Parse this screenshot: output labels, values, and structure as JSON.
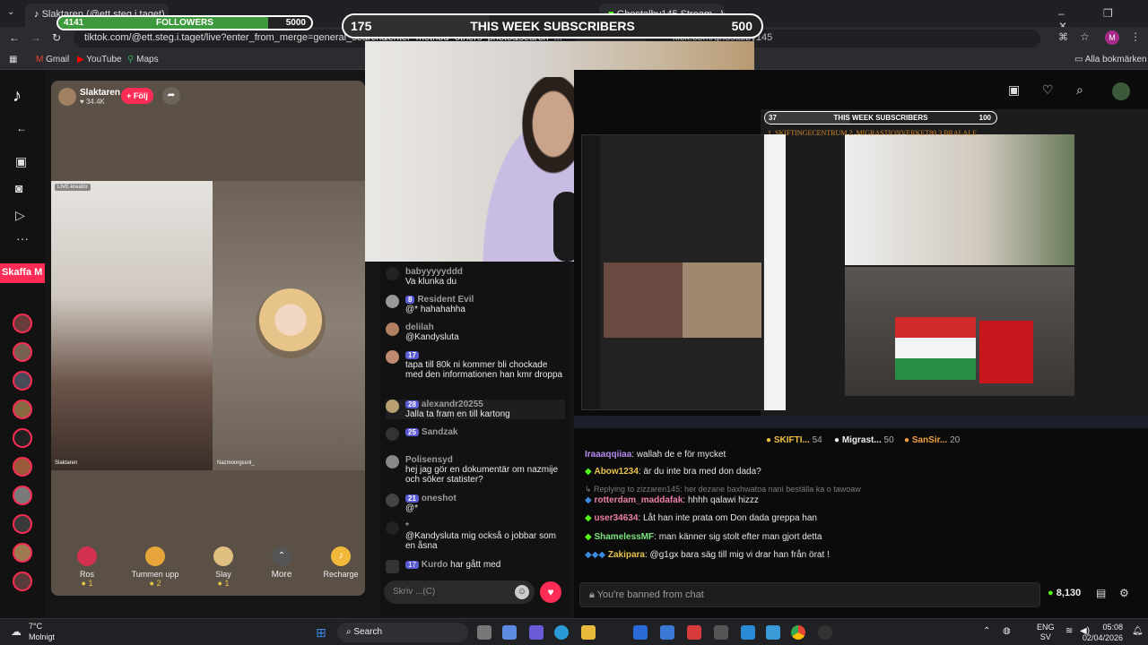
{
  "browser_left": {
    "tab_title": "Slaktaren (@ett.steg.i.taget)",
    "url": "tiktok.com/@ett.steg.i.taget/live?enter_from_merge=general_search&enter_method=others_photo&search_..."
  },
  "browser_right": {
    "tab_title": "Ghostalby145 Stream - Watch",
    "url": "kick.com/ghostalby145"
  },
  "bookmarks": {
    "gmail": "Gmail",
    "youtube": "YouTube",
    "maps": "Maps",
    "all": "Alla bokmärken"
  },
  "followers_bar": {
    "current": "4141",
    "label": "FOLLOWERS",
    "goal": "5000",
    "progress": 0.83
  },
  "subs_bar": {
    "current": "175",
    "label": "THIS WEEK SUBSCRIBERS",
    "goal": "500",
    "progress": 0.35
  },
  "kick_subs_bar": {
    "current": "37",
    "label": "THIS WEEK SUBSCRIBERS",
    "goal": "100",
    "progress": 0.37
  },
  "kick_marquee": "1. SKIFTINGECENTRUM  2. MIGRASTIONVERKET80 3 BRALALE",
  "tiktok": {
    "host_name": "Slaktaren",
    "host_likes": "34.4K",
    "follow_label": "+ Följ",
    "side_promo": "Skaffa M",
    "left_label": "LIVE-kreatör",
    "left_caption": "Slaktaren",
    "right_caption": "Nazmoorgssnl_",
    "gifts": [
      {
        "name": "Ros",
        "cost": "1"
      },
      {
        "name": "Tummen upp",
        "cost": "2"
      },
      {
        "name": "Slay",
        "cost": "1"
      }
    ],
    "more_label": "More",
    "recharge_label": "Recharge",
    "input_placeholder": "Skriv ...(C)"
  },
  "tt_chat": [
    {
      "user": "babyyyyyddd",
      "text": "Va klunka du",
      "badge": ""
    },
    {
      "user": "Resident Evil",
      "text": "@* hahahahha",
      "badge": "8"
    },
    {
      "user": "delilah",
      "text": "@Kandysluta",
      "badge": ""
    },
    {
      "user": "",
      "text": "tapa till 80k ni kommer bli chockade med den informationen han kmr droppa",
      "badge": "17"
    },
    {
      "user": "alexandr20255",
      "text": "Jalla ta fram en till kartong",
      "badge": "28"
    },
    {
      "user": "Sandzak",
      "text": "",
      "badge": "25"
    },
    {
      "user": "Polisensyd",
      "text": "hej jag gör en dokumentär om nazmije och söker statister?",
      "badge": ""
    },
    {
      "user": "oneshot",
      "text": "@*",
      "badge": "21"
    },
    {
      "user": "*",
      "text": "@Kandysluta mig också o jobbar som en åsna",
      "badge": ""
    },
    {
      "user": "Kurdo",
      "text": "har gått med",
      "badge": "17"
    }
  ],
  "kick": {
    "poll": [
      {
        "name": "SKIFTI...",
        "count": "54"
      },
      {
        "name": "Migrast...",
        "count": "50"
      },
      {
        "name": "SanSir...",
        "count": "20"
      }
    ],
    "chat": [
      {
        "user": "Iraaaqqiiaa",
        "text": ": wallah de e för mycket",
        "color": "#b58cf0"
      },
      {
        "user": "Abow1234",
        "text": ": är du inte bra med don dada?",
        "color": "#e7c24a"
      },
      {
        "user": "",
        "text": "Replying to zizzaren145: her dezane baxhwatoa nani beställa ka o tawoaw",
        "color": "#7c7c7c"
      },
      {
        "user": "rotterdam_maddafak",
        "text": ": hhhh qalawi hizzz",
        "color": "#ea7ea8"
      },
      {
        "user": "user34634",
        "text": ": Låt han inte prata om Don dada greppa han",
        "color": "#ea7ea8"
      },
      {
        "user": "ShamelessMF",
        "text": ": man känner sig stolt efter man gjort detta",
        "color": "#7ce47c"
      },
      {
        "user": "Zakipara",
        "text": ": @g1gx bara säg till mig vi drar han från örat !",
        "color": "#e7c24a"
      }
    ],
    "banned_text": "You're banned from chat",
    "points": "8,130"
  },
  "taskbar": {
    "weather_temp": "7°C",
    "weather_desc": "Molnigt",
    "search": "Search",
    "lang": "ENG",
    "lang2": "SV",
    "time": "05:08",
    "date": "02/04/2026"
  }
}
